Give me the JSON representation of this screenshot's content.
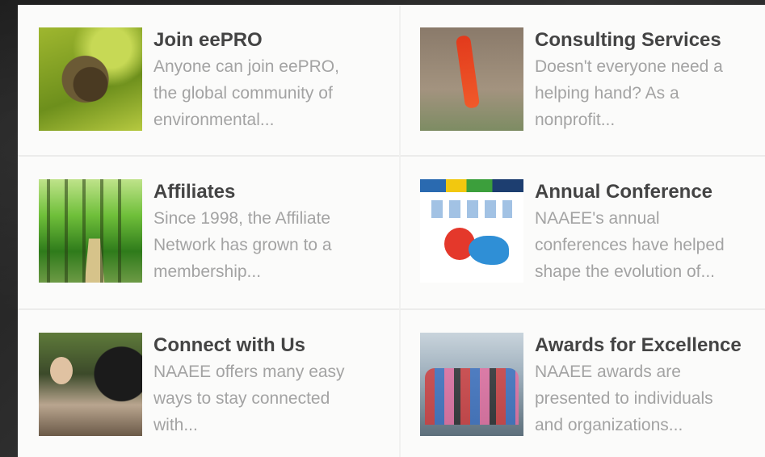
{
  "cards": [
    {
      "title": "Join eePRO",
      "lines": [
        "Anyone can join eePRO,",
        "the global community of",
        "environmental..."
      ],
      "image": "leaf-insect-image"
    },
    {
      "title": "Consulting Services",
      "lines": [
        "Doesn't everyone need a",
        "helping hand? As a",
        "nonprofit..."
      ],
      "image": "red-plant-image"
    },
    {
      "title": "Affiliates",
      "lines": [
        "Since 1998, the Affiliate",
        "Network has grown to a",
        "membership..."
      ],
      "image": "forest-path-image"
    },
    {
      "title": "Annual Conference",
      "lines": [
        "NAAEE's annual",
        "conferences have helped",
        "shape the evolution of..."
      ],
      "image": "conference-poster-image"
    },
    {
      "title": "Connect with Us",
      "lines": [
        "NAAEE offers many easy",
        "ways to stay connected",
        "with..."
      ],
      "image": "people-binoculars-image"
    },
    {
      "title": "Awards for Excellence",
      "lines": [
        "NAAEE awards are",
        "presented to individuals",
        "and organizations..."
      ],
      "image": "award-group-image"
    }
  ]
}
